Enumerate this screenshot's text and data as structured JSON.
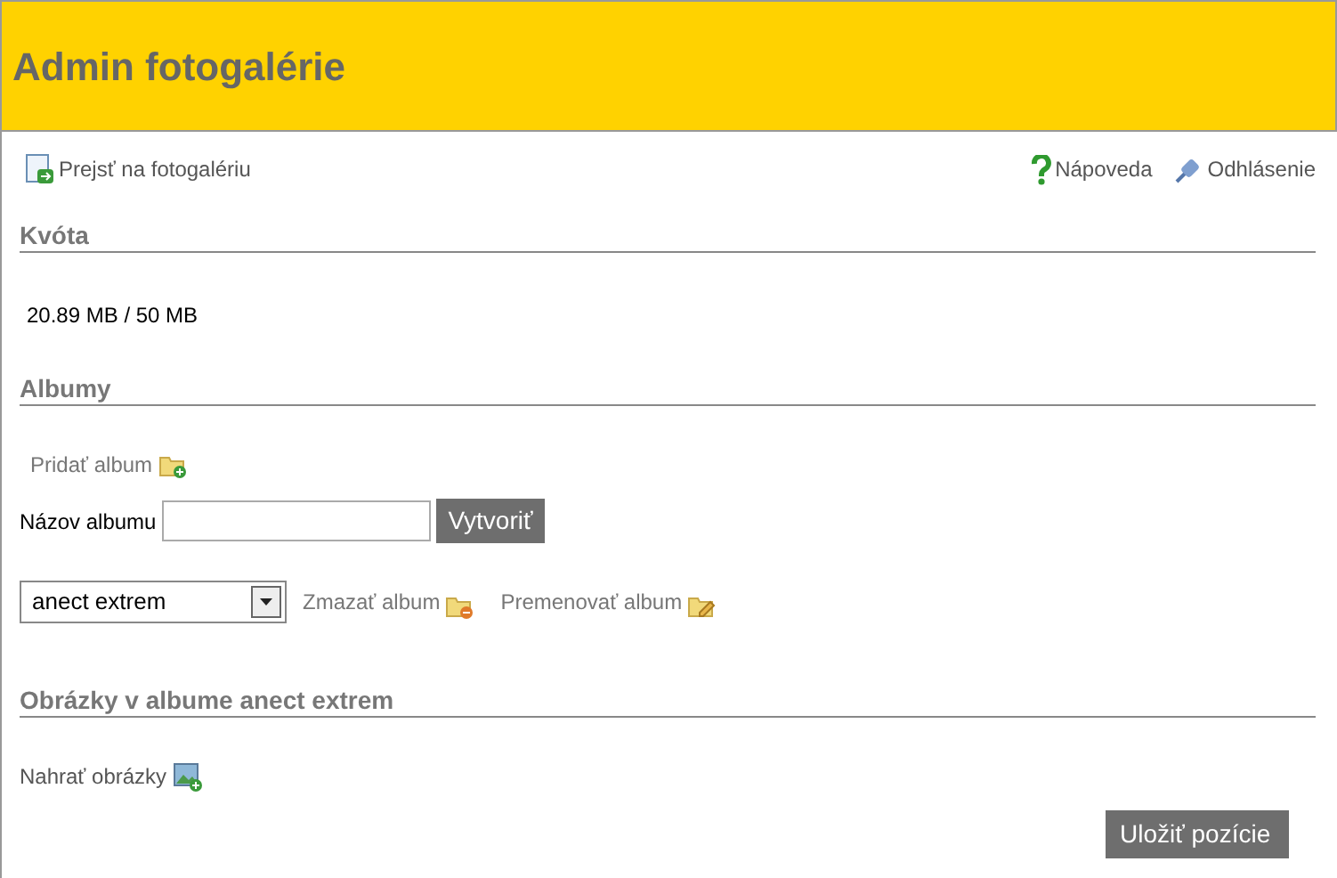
{
  "header": {
    "title": "Admin fotogalérie"
  },
  "top_links": {
    "gallery": "Prejsť na fotogalériu",
    "help": "Nápoveda",
    "logout": "Odhlásenie"
  },
  "quota": {
    "heading": "Kvóta",
    "usage": "20.89 MB / 50 MB"
  },
  "albums": {
    "heading": "Albumy",
    "add_album": "Pridať album",
    "name_label": "Názov albumu",
    "create_button": "Vytvoriť",
    "selected_album": "anect extrem",
    "delete_album": "Zmazať album",
    "rename_album": "Premenovať album"
  },
  "images": {
    "heading": "Obrázky v albume anect extrem",
    "upload": "Nahrať obrázky",
    "save_button": "Uložiť pozície"
  }
}
